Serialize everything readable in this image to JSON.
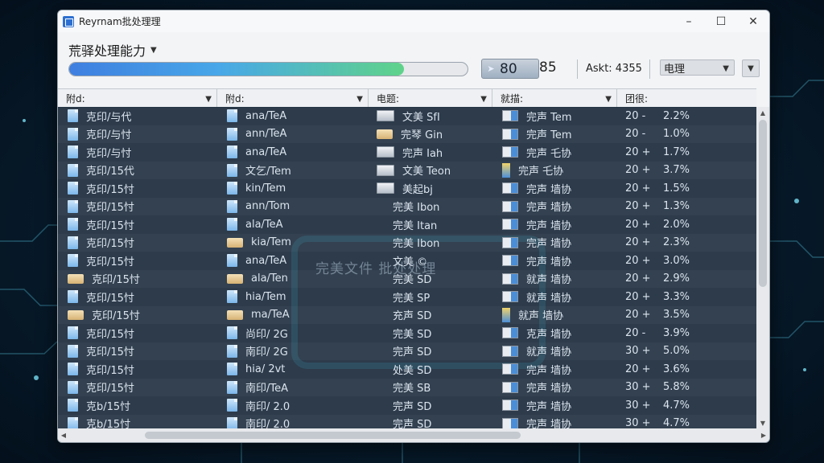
{
  "window": {
    "title": "Reyrnam批处理理"
  },
  "toolbar": {
    "mode_label": "荒驿处理能力",
    "progress_fraction": 0.84,
    "counter_value": "80",
    "counter_total": "85",
    "status_text": "Askt: 4355",
    "action_label": "电理"
  },
  "columns": [
    {
      "label": "附d:"
    },
    {
      "label": "附d:"
    },
    {
      "label": "电题:"
    },
    {
      "label": "就描:"
    },
    {
      "label": "团很:"
    }
  ],
  "watermark": "完美文件 批处处理",
  "rows": [
    {
      "c1": "克印/与代",
      "i1": "doc",
      "c2": "ana/TeA",
      "i2": "doc",
      "c3": "文美 SfI",
      "i3": "slab",
      "c4": "完声 Tem",
      "i4": "card",
      "c5a": "20 -",
      "c5b": "2.2%"
    },
    {
      "c1": "克印/与忖",
      "i1": "doc",
      "c2": "ann/TeA",
      "i2": "doc",
      "c3": "完琴 Gin",
      "i3": "folder",
      "c4": "完声 Tem",
      "i4": "card",
      "c5a": "20 -",
      "c5b": "1.0%"
    },
    {
      "c1": "克印/与忖",
      "i1": "doc",
      "c2": "ana/TeA",
      "i2": "doc",
      "c3": "完声 Iah",
      "i3": "slab",
      "c4": "完声 乇协",
      "i4": "card",
      "c5a": "20 +",
      "c5b": "1.7%"
    },
    {
      "c1": "克印/15代",
      "i1": "doc",
      "c2": "文乞/Tem",
      "i2": "doc",
      "c3": "文美 Teon",
      "i3": "slab",
      "c4": "完声 乇协",
      "i4": "bar",
      "c5a": "20 +",
      "c5b": "3.7%"
    },
    {
      "c1": "克印/15忖",
      "i1": "doc",
      "c2": "kin/Tem",
      "i2": "doc",
      "c3": "美起bj",
      "i3": "slab",
      "c4": "完声 墙协",
      "i4": "card",
      "c5a": "20 +",
      "c5b": "1.5%"
    },
    {
      "c1": "克印/15忖",
      "i1": "doc",
      "c2": "ann/Tom",
      "i2": "doc",
      "c3": "完美 Ibon",
      "i3": "",
      "c4": "完声 墙协",
      "i4": "card",
      "c5a": "20 +",
      "c5b": "1.3%"
    },
    {
      "c1": "克印/15忖",
      "i1": "doc",
      "c2": "ala/TeA",
      "i2": "doc",
      "c3": "完美 Itan",
      "i3": "",
      "c4": "完声 墙协",
      "i4": "card",
      "c5a": "20 +",
      "c5b": "2.0%"
    },
    {
      "c1": "克印/15忖",
      "i1": "doc",
      "c2": "kia/Tem",
      "i2": "folder",
      "c3": "完美 Ibon",
      "i3": "",
      "c4": "完声 墙协",
      "i4": "card",
      "c5a": "20 +",
      "c5b": "2.3%"
    },
    {
      "c1": "克印/15忖",
      "i1": "doc",
      "c2": "ana/TeA",
      "i2": "doc",
      "c3": "文美 ©",
      "i3": "",
      "c4": "完声 墙协",
      "i4": "card",
      "c5a": "20 +",
      "c5b": "3.0%"
    },
    {
      "c1": "克印/15忖",
      "i1": "folder",
      "c2": "ala/Ten",
      "i2": "folder",
      "c3": "完美 SD",
      "i3": "",
      "c4": "就声 墙协",
      "i4": "card",
      "c5a": "20 +",
      "c5b": "2.9%"
    },
    {
      "c1": "克印/15忖",
      "i1": "doc",
      "c2": "hia/Tem",
      "i2": "doc",
      "c3": "完美 SP",
      "i3": "",
      "c4": "就声 墙协",
      "i4": "card",
      "c5a": "20 +",
      "c5b": "3.3%"
    },
    {
      "c1": "克印/15忖",
      "i1": "folder",
      "c2": "ma/TeA",
      "i2": "folder",
      "c3": "充声 SD",
      "i3": "",
      "c4": "就声 墙协",
      "i4": "bar",
      "c5a": "20 +",
      "c5b": "3.5%"
    },
    {
      "c1": "克印/15忖",
      "i1": "doc",
      "c2": "尚印/ 2G",
      "i2": "doc",
      "c3": "完美 SD",
      "i3": "",
      "c4": "克声 墙协",
      "i4": "card",
      "c5a": "20 -",
      "c5b": "3.9%"
    },
    {
      "c1": "克印/15忖",
      "i1": "doc",
      "c2": "南印/ 2G",
      "i2": "doc",
      "c3": "完声 SD",
      "i3": "",
      "c4": "就声 墙协",
      "i4": "card",
      "c5a": "30 +",
      "c5b": "5.0%"
    },
    {
      "c1": "克印/15忖",
      "i1": "doc",
      "c2": "hia/ 2vt",
      "i2": "doc",
      "c3": "处美 SD",
      "i3": "",
      "c4": "完声 墙协",
      "i4": "card",
      "c5a": "20 +",
      "c5b": "3.6%"
    },
    {
      "c1": "克印/15忖",
      "i1": "doc",
      "c2": "南印/TeA",
      "i2": "doc",
      "c3": "完美 SB",
      "i3": "",
      "c4": "完声 墙协",
      "i4": "card",
      "c5a": "30 +",
      "c5b": "5.8%"
    },
    {
      "c1": "克b/15忖",
      "i1": "doc",
      "c2": "南印/ 2.0",
      "i2": "doc",
      "c3": "完声 SD",
      "i3": "",
      "c4": "完声 墙协",
      "i4": "card",
      "c5a": "30 +",
      "c5b": "4.7%"
    },
    {
      "c1": "克b/15忖",
      "i1": "doc",
      "c2": "南印/ 2.0",
      "i2": "doc",
      "c3": "完声 SD",
      "i3": "",
      "c4": "完声 墙协",
      "i4": "card",
      "c5a": "30 +",
      "c5b": "4.7%"
    }
  ]
}
